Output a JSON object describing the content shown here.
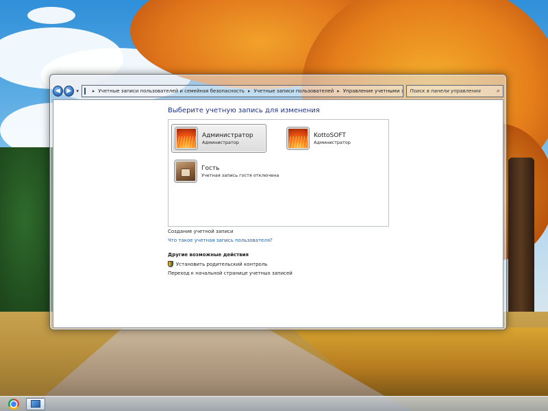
{
  "toolbar": {
    "back_icon": "back-arrow-icon",
    "forward_icon": "forward-arrow-icon",
    "breadcrumbs": [
      "Учетные записи пользователей и семейная безопасность",
      "Учетные записи пользователей",
      "Управление учетными записями"
    ],
    "breadcrumb_separator": "▸",
    "search_placeholder": "Поиск в панели управления"
  },
  "main": {
    "heading": "Выберите учетную запись для изменения",
    "accounts": [
      {
        "name": "Администратор",
        "role": "Администратор",
        "avatar": "flower-orange-icon",
        "selected": true
      },
      {
        "name": "KottoSOFT",
        "role": "Администратор",
        "avatar": "flower-orange-icon",
        "selected": false
      },
      {
        "name": "Гость",
        "role": "Учетная запись гостя отключена",
        "avatar": "guest-suitcase-icon",
        "selected": false
      }
    ],
    "create_account": "Создание учетной записи",
    "what_is_account": "Что такое учетная запись пользователя?",
    "other_actions_title": "Другие возможные действия",
    "parental_control": "Установить родительский контроль",
    "go_home": "Переход к начальной странице учетных записей"
  },
  "taskbar": {
    "items": [
      "chrome-icon",
      "control-panel-icon"
    ]
  },
  "colors": {
    "heading": "#1e3287",
    "link": "#1a62b0",
    "selected_bg": "#dcdcdc"
  }
}
